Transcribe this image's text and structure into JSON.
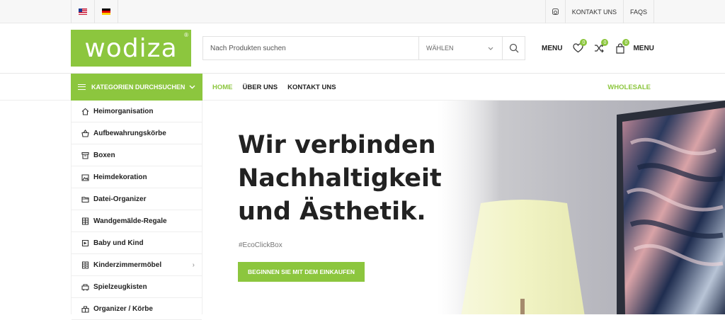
{
  "topbar": {
    "flags": [
      {
        "name": "us-flag"
      },
      {
        "name": "de-flag"
      }
    ],
    "links": [
      {
        "icon": "instagram-icon"
      },
      {
        "label": "KONTAKT UNS"
      },
      {
        "label": "FAQS"
      }
    ]
  },
  "header": {
    "logo_text": "wodiza",
    "logo_reg": "®",
    "search_placeholder": "Nach Produkten suchen",
    "category_select": "WÄHLEN",
    "menu_label_left": "MENU",
    "wishlist_count": "0",
    "compare_count": "0",
    "cart_count": "0",
    "menu_label_right": "MENU"
  },
  "nav": {
    "categories_button": "KATEGORIEN DURCHSUCHEN",
    "links": [
      "HOME",
      "ÜBER UNS",
      "KONTAKT UNS"
    ],
    "wholesale": "WHOLESALE"
  },
  "sidebar": {
    "items": [
      {
        "label": "Heimorganisation",
        "icon": "home-icon"
      },
      {
        "label": "Aufbewahrungskörbe",
        "icon": "basket-icon"
      },
      {
        "label": "Boxen",
        "icon": "box-icon"
      },
      {
        "label": "Heimdekoration",
        "icon": "picture-icon"
      },
      {
        "label": "Datei-Organizer",
        "icon": "folder-icon"
      },
      {
        "label": "Wandgemälde-Regale",
        "icon": "shelf-icon"
      },
      {
        "label": "Baby und Kind",
        "icon": "baby-icon"
      },
      {
        "label": "Kinderzimmermöbel",
        "icon": "furniture-icon"
      },
      {
        "label": "Spielzeugkisten",
        "icon": "toy-icon"
      },
      {
        "label": "Organizer / Körbe",
        "icon": "organizer-icon"
      }
    ]
  },
  "hero": {
    "title_lines": [
      "Wir verbinden",
      "Nachhaltigkeit",
      "und Ästhetik."
    ],
    "tag": "#EcoClickBox",
    "button": "BEGINNEN SIE MIT DEM EINKAUFEN"
  },
  "colors": {
    "brand": "#8cc63e",
    "text": "#222222"
  }
}
